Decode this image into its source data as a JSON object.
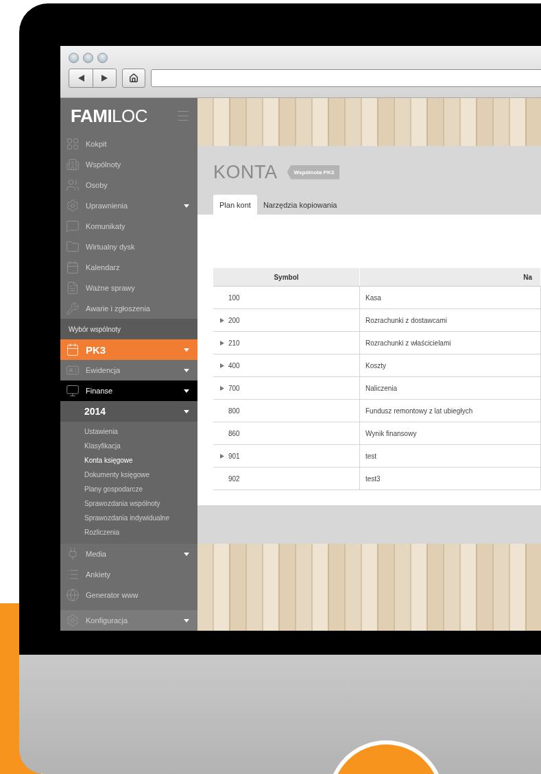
{
  "sidebar": {
    "logo": "**FAMI**LOC",
    "menu": [
      {
        "kind": "nav",
        "label": "Kokpit",
        "dropdown": false,
        "selected": false
      },
      {
        "kind": "nav",
        "label": "Wspólnoty",
        "dropdown": false,
        "selected": false
      },
      {
        "kind": "nav",
        "label": "Osoby",
        "dropdown": false,
        "selected": false
      },
      {
        "kind": "nav",
        "label": "Uprawnienia",
        "dropdown": true,
        "selected": false
      },
      {
        "kind": "nav",
        "label": "Komunikaty",
        "dropdown": false,
        "selected": false
      },
      {
        "kind": "nav",
        "label": "Wirtualny dysk",
        "dropdown": false,
        "selected": false
      },
      {
        "kind": "nav",
        "label": "Kalendarz",
        "dropdown": false,
        "selected": false
      },
      {
        "kind": "nav",
        "label": "Ważne sprawy",
        "dropdown": false,
        "selected": false
      },
      {
        "kind": "nav",
        "label": "Awarie i zgłoszenia",
        "dropdown": false,
        "selected": false
      },
      {
        "kind": "header",
        "label": "Wybór wspólnoty"
      },
      {
        "kind": "community",
        "label": "PK3",
        "dropdown": true
      },
      {
        "kind": "nav",
        "label": "Ewidencja",
        "dropdown": true,
        "selected": false
      },
      {
        "kind": "nav",
        "label": "Finanse",
        "dropdown": true,
        "selected": true
      },
      {
        "kind": "year",
        "label": "2014",
        "dropdown": true
      },
      {
        "kind": "subitem",
        "label": "Ustawienia",
        "selected": false
      },
      {
        "kind": "subitem",
        "label": "Klasyfikacja",
        "selected": false
      },
      {
        "kind": "subitem",
        "label": "Konta księgowe",
        "selected": true
      },
      {
        "kind": "subitem",
        "label": "Dokumenty księgowe",
        "selected": false
      },
      {
        "kind": "subitem",
        "label": "Plany gospodarcze",
        "selected": false
      },
      {
        "kind": "subitem",
        "label": "Sprawozdania wspólnoty",
        "selected": false
      },
      {
        "kind": "subitem",
        "label": "Sprawozdania indywidualne",
        "selected": false
      },
      {
        "kind": "subitem",
        "label": "Rozliczenia",
        "selected": false
      },
      {
        "kind": "nav",
        "label": "Media",
        "dropdown": true,
        "selected": false
      },
      {
        "kind": "nav",
        "label": "Ankiety",
        "dropdown": false,
        "selected": false
      },
      {
        "kind": "nav",
        "label": "Generator www",
        "dropdown": false,
        "selected": false
      }
    ],
    "footer": {
      "label": "Konfiguracja",
      "dropdown": true
    }
  },
  "page": {
    "title": "KONTA",
    "badge": "Wspólnota PK3",
    "tabs": [
      {
        "label": "Plan kont",
        "selected": true
      },
      {
        "label": "Narzędzia kopiowania",
        "selected": false
      }
    ]
  },
  "table": {
    "columns": [
      "Symbol",
      "Na"
    ],
    "rows": [
      {
        "symbol": "100",
        "name": "Kasa",
        "expandable": false
      },
      {
        "symbol": "200",
        "name": "Rozrachunki z dostawcami",
        "expandable": true
      },
      {
        "symbol": "210",
        "name": "Rozrachunki z właścicielami",
        "expandable": true
      },
      {
        "symbol": "400",
        "name": "Koszty",
        "expandable": true
      },
      {
        "symbol": "700",
        "name": "Naliczenia",
        "expandable": true
      },
      {
        "symbol": "800",
        "name": "Fundusz remontowy z lat ubiegłych",
        "expandable": false
      },
      {
        "symbol": "860",
        "name": "Wynik finansowy",
        "expandable": false
      },
      {
        "symbol": "901",
        "name": "test",
        "expandable": true
      },
      {
        "symbol": "902",
        "name": "test3",
        "expandable": false
      }
    ]
  }
}
